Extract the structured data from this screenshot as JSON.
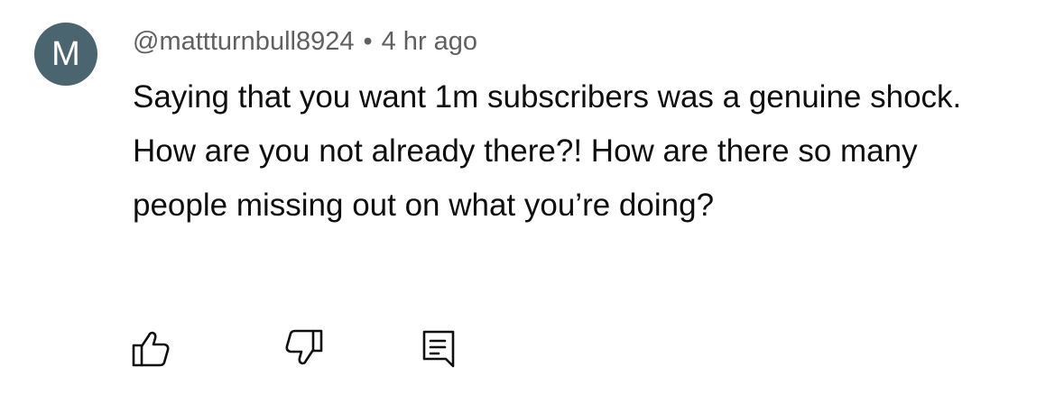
{
  "comment": {
    "avatar_letter": "M",
    "avatar_color": "#4a6470",
    "username": "@mattturnbull8924",
    "separator": "•",
    "timestamp": "4 hr ago",
    "text": "Saying that you want 1m subscribers was a genuine shock. How are you not already there?! How are there so many people missing out on what you’re doing?"
  },
  "actions": {
    "like_icon": "thumbs-up-icon",
    "dislike_icon": "thumbs-down-icon",
    "reply_icon": "comment-reply-icon"
  }
}
